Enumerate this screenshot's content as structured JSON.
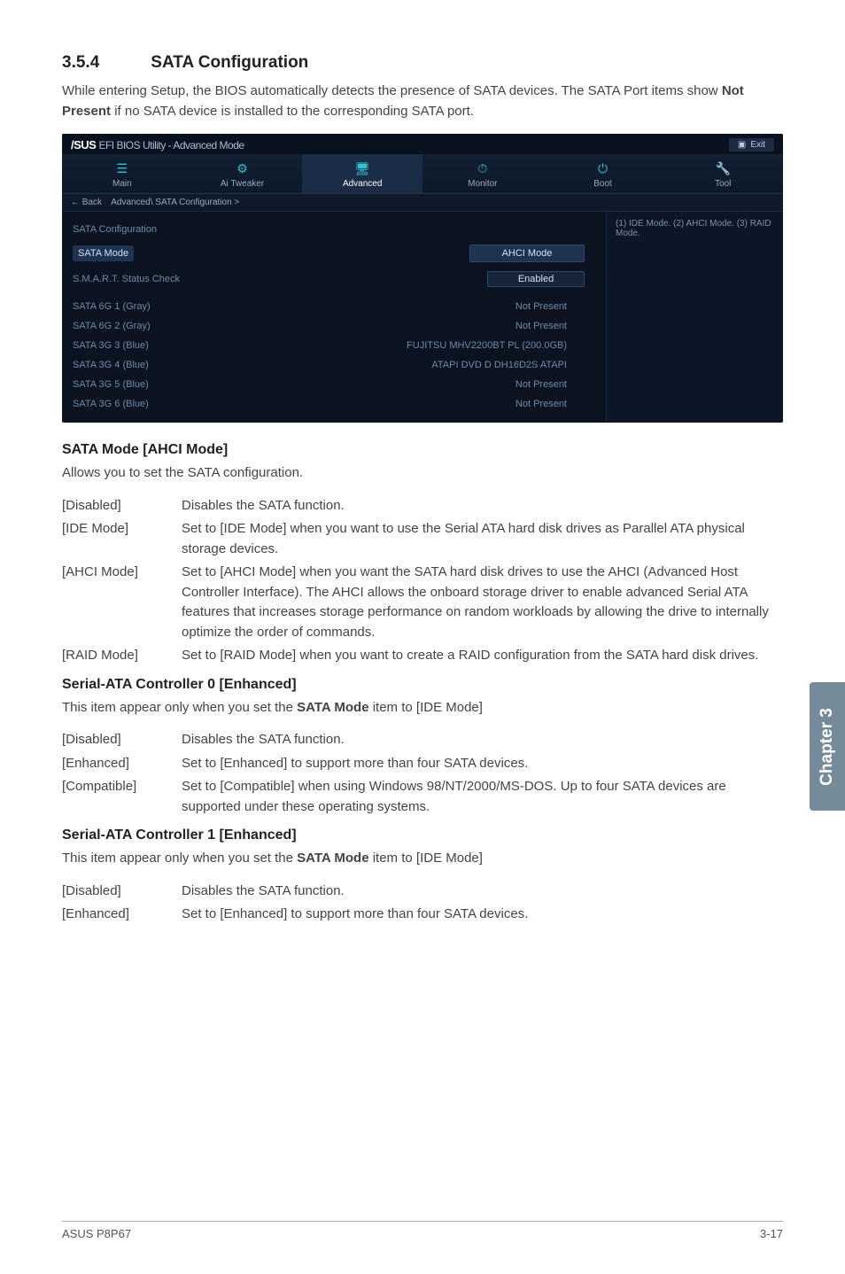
{
  "section": {
    "number": "3.5.4",
    "title": "SATA Configuration"
  },
  "intro": {
    "pre": "While entering Setup, the BIOS automatically detects the presence of SATA devices. The SATA Port items show ",
    "bold": "Not Present",
    "post": " if no SATA device is installed to the corresponding SATA port."
  },
  "bios": {
    "logo_brand": "/SUS",
    "logo_util": "EFI BIOS Utility - Advanced Mode",
    "exit_label": "Exit",
    "tabs": [
      {
        "icon": "☰",
        "label": "Main"
      },
      {
        "icon": "⚙",
        "label": "Ai  Tweaker"
      },
      {
        "icon": "🖥",
        "label": "Advanced"
      },
      {
        "icon": "⏱",
        "label": "Monitor"
      },
      {
        "icon": "⏻",
        "label": "Boot"
      },
      {
        "icon": "🔧",
        "label": "Tool"
      }
    ],
    "breadcrumb_back": "←  Back",
    "breadcrumb_path": "Advanced\\  SATA Configuration  >",
    "section_title": "SATA Configuration",
    "rows": [
      {
        "label": "SATA Mode",
        "value": "AHCI Mode",
        "style": "highlight"
      },
      {
        "label": "S.M.A.R.T. Status Check",
        "value": "Enabled",
        "style": "box"
      },
      {
        "label": "SATA 6G 1 (Gray)",
        "value": "Not Present",
        "style": "plain"
      },
      {
        "label": "SATA 6G 2 (Gray)",
        "value": "Not Present",
        "style": "plain"
      },
      {
        "label": "SATA 3G 3 (Blue)",
        "value": "FUJITSU MHV2200BT PL (200.0GB)",
        "style": "plain"
      },
      {
        "label": "SATA 3G 4 (Blue)",
        "value": "ATAPI DVD D DH16D2S ATAPI",
        "style": "plain"
      },
      {
        "label": "SATA 3G 5 (Blue)",
        "value": "Not Present",
        "style": "plain"
      },
      {
        "label": "SATA 3G 6 (Blue)",
        "value": "Not Present",
        "style": "plain"
      }
    ],
    "help_text": "(1) IDE Mode. (2) AHCI Mode. (3) RAID Mode."
  },
  "sata_mode": {
    "heading": "SATA Mode [AHCI Mode]",
    "desc": "Allows you to set the SATA configuration.",
    "options": [
      {
        "key": "[Disabled]",
        "val": "Disables the SATA function."
      },
      {
        "key": "[IDE Mode]",
        "val": "Set to [IDE Mode] when you want to use the Serial ATA hard disk drives as Parallel ATA physical storage devices."
      },
      {
        "key": "[AHCI Mode]",
        "val": "Set to [AHCI Mode] when you want the SATA hard disk drives to use the AHCI (Advanced Host Controller Interface). The AHCI allows the onboard storage driver to enable advanced Serial ATA features that increases storage performance on random workloads by allowing the drive to internally optimize the order of commands."
      },
      {
        "key": "[RAID Mode]",
        "val": "Set to [RAID Mode] when you want to create a RAID configuration from the SATA hard disk drives."
      }
    ]
  },
  "serial0": {
    "heading": "Serial-ATA Controller 0 [Enhanced]",
    "desc_pre": "This item appear only when you set the ",
    "desc_bold": "SATA Mode",
    "desc_post": " item to [IDE Mode]",
    "options": [
      {
        "key": "[Disabled]",
        "val": "Disables the SATA function."
      },
      {
        "key": "[Enhanced]",
        "val": "Set to [Enhanced] to support more than four SATA devices."
      },
      {
        "key": "[Compatible]",
        "val": "Set to [Compatible] when using Windows 98/NT/2000/MS-DOS. Up to four SATA devices are supported under these operating systems."
      }
    ]
  },
  "serial1": {
    "heading": "Serial-ATA Controller 1 [Enhanced]",
    "desc_pre": "This item appear only when you set the ",
    "desc_bold": "SATA Mode",
    "desc_post": " item to [IDE Mode]",
    "options": [
      {
        "key": "[Disabled]",
        "val": "Disables the SATA function."
      },
      {
        "key": "[Enhanced]",
        "val": "Set to [Enhanced] to support more than four SATA devices."
      }
    ]
  },
  "side_tab": "Chapter 3",
  "footer": {
    "left": "ASUS P8P67",
    "right": "3-17"
  }
}
